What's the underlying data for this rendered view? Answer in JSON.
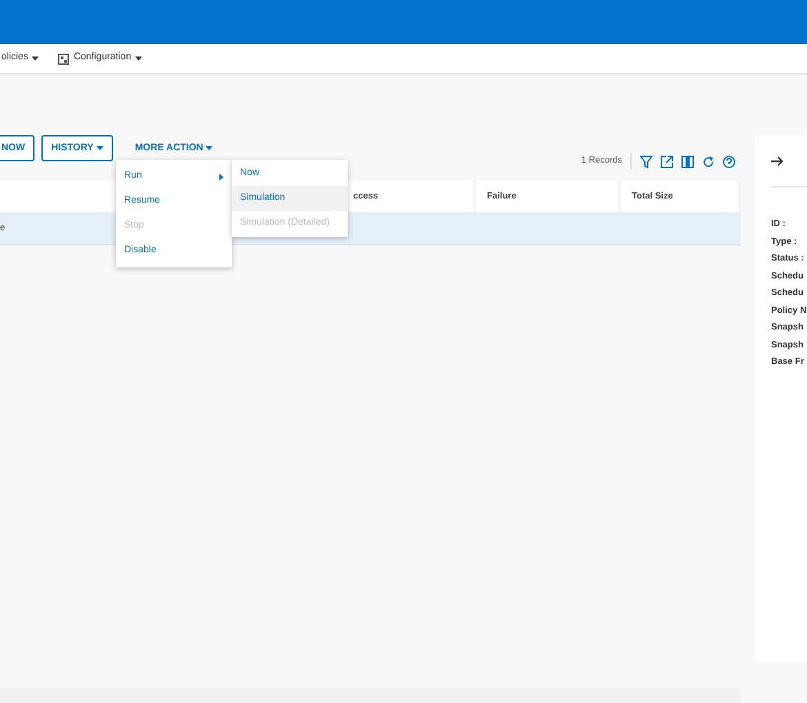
{
  "nav": [
    {
      "label": "olicies"
    },
    {
      "label": "Configuration"
    }
  ],
  "toolbar": {
    "buttons": [
      {
        "label": "NOW",
        "kind": "outline",
        "caret": false
      },
      {
        "label": "HISTORY",
        "kind": "outline",
        "caret": true
      },
      {
        "label": "MORE ACTION",
        "kind": "link",
        "caret": true
      }
    ],
    "records": "1 Records"
  },
  "menu": {
    "items": [
      {
        "label": "Run",
        "disabled": false,
        "submenu": true
      },
      {
        "label": "Resume",
        "disabled": false,
        "submenu": false
      },
      {
        "label": "Stop",
        "disabled": true,
        "submenu": false
      },
      {
        "label": "Disable",
        "disabled": false,
        "submenu": false
      }
    ],
    "submenu": [
      {
        "label": "Now",
        "disabled": false,
        "selected": false
      },
      {
        "label": "Simulation",
        "disabled": false,
        "selected": true
      },
      {
        "label": "Simulation (Detailed)",
        "disabled": true,
        "selected": false
      }
    ]
  },
  "table": {
    "columns": [
      "",
      "ccess",
      "Failure",
      "Total Size"
    ],
    "rows": [
      {
        "cells": [
          "e",
          "",
          "",
          ""
        ],
        "selected": true
      }
    ]
  },
  "details": {
    "labels": [
      "ID :",
      "Type :",
      "Status :",
      "Schedu",
      "Schedu",
      "Policy N",
      "Snapsh",
      "Snapsh",
      "Base Fr"
    ]
  }
}
